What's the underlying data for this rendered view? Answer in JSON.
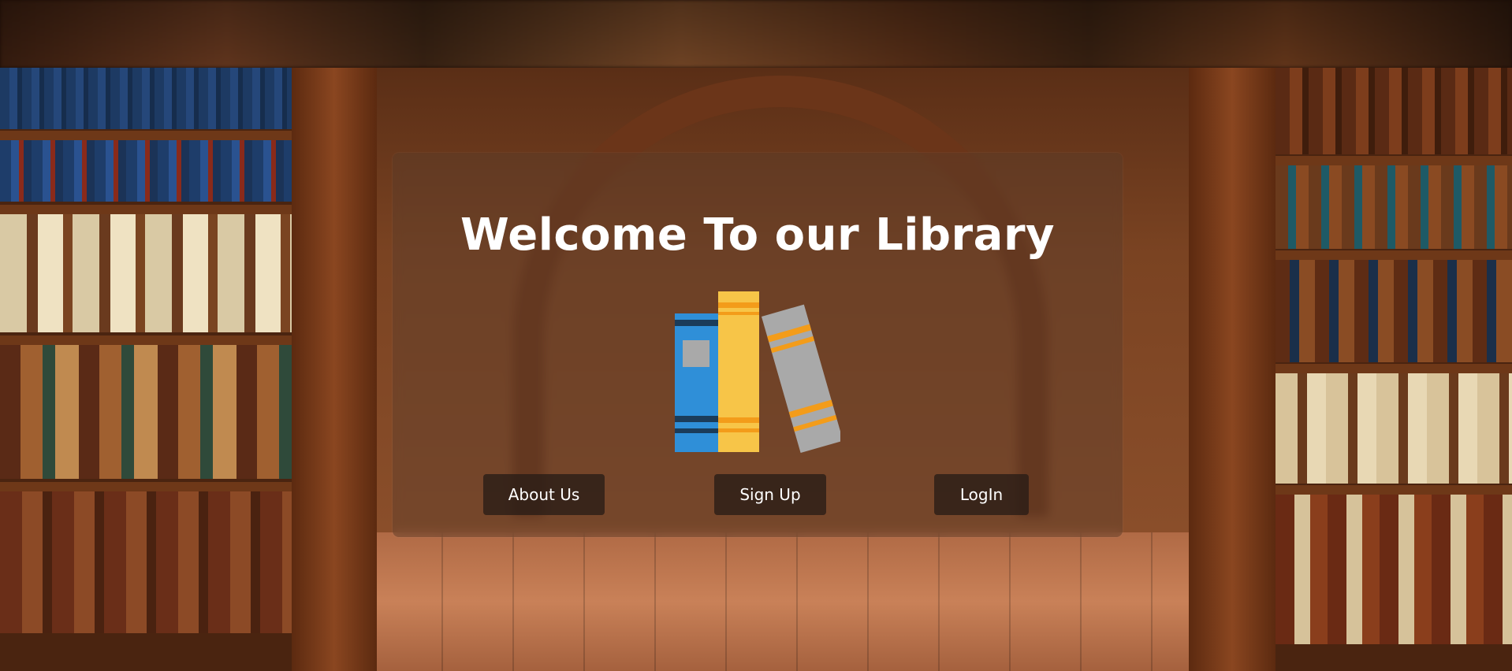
{
  "hero": {
    "title": "Welcome To our Library"
  },
  "logo": {
    "icon": "books-icon",
    "colors": {
      "blue": "#2f8fd8",
      "yellow": "#f7c548",
      "gray": "#a9a9a9",
      "orange": "#f39c1a",
      "dark": "#1b3c5a"
    }
  },
  "nav": {
    "about_label": "About Us",
    "signup_label": "Sign Up",
    "login_label": "LogIn"
  },
  "theme": {
    "button_bg": "#2a1c16",
    "text": "#ffffff"
  }
}
